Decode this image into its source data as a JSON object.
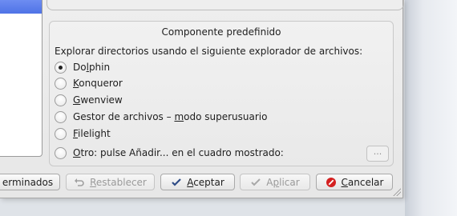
{
  "groupbox": {
    "title": "Componente predefinido",
    "intro": "Explorar directorios usando el siguiente explorador de archivos:"
  },
  "options": [
    {
      "pre": "Do",
      "ul": "l",
      "post": "phin",
      "checked": true
    },
    {
      "pre": "",
      "ul": "K",
      "post": "onqueror",
      "checked": false
    },
    {
      "pre": "",
      "ul": "G",
      "post": "wenview",
      "checked": false
    },
    {
      "pre": "Gestor de archivos – ",
      "ul": "m",
      "post": "odo superusuario",
      "checked": false
    },
    {
      "pre": "",
      "ul": "F",
      "post": "ilelight",
      "checked": false
    },
    {
      "pre": "",
      "ul": "O",
      "post": "tro: pulse Añadir... en el cuadro mostrado:",
      "checked": false
    }
  ],
  "other_button": "...",
  "buttons": {
    "defaults": "erminados",
    "reset": {
      "pre": "",
      "ul": "R",
      "post": "establecer"
    },
    "accept": {
      "pre": "",
      "ul": "A",
      "post": "ceptar"
    },
    "apply": {
      "pre": "A",
      "ul": "p",
      "post": "licar"
    },
    "cancel": {
      "pre": "",
      "ul": "C",
      "post": "ancelar"
    }
  },
  "colors": {
    "selection": "#5a7dea",
    "cancel_icon": "#d42020"
  }
}
